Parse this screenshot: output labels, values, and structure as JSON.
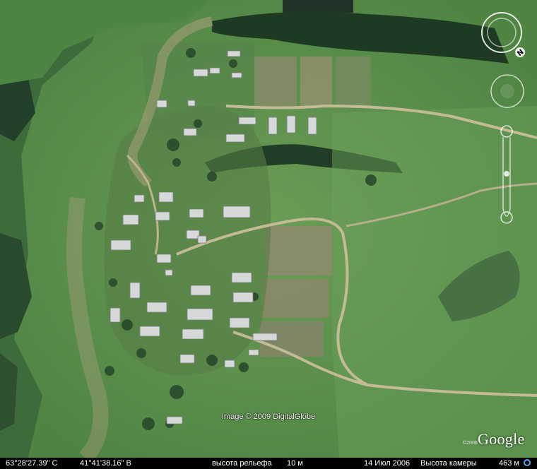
{
  "map": {
    "view": "satellite",
    "attribution": "Image © 2009 DigitalGlobe",
    "brand": {
      "year": "©2008",
      "word": "Google"
    },
    "compass_letter": "N"
  },
  "statusbar": {
    "latitude": "63°28'27.39\" С",
    "longitude": "41°41'38.16\" В",
    "elevation_label": "высота рельефа",
    "elevation_value": "10 м",
    "imagery_date": "14 Июл 2006",
    "camera_label": "Высота камеры",
    "camera_value": "463 м"
  },
  "colors": {
    "grass": "#5a8f4a",
    "grass_dark": "#3b6a36",
    "forest": "#1e3a22",
    "road": "#b8b08a",
    "roof": "#cfd2d4",
    "statusbar": "#000000",
    "indicator": "#5aa6e8"
  }
}
